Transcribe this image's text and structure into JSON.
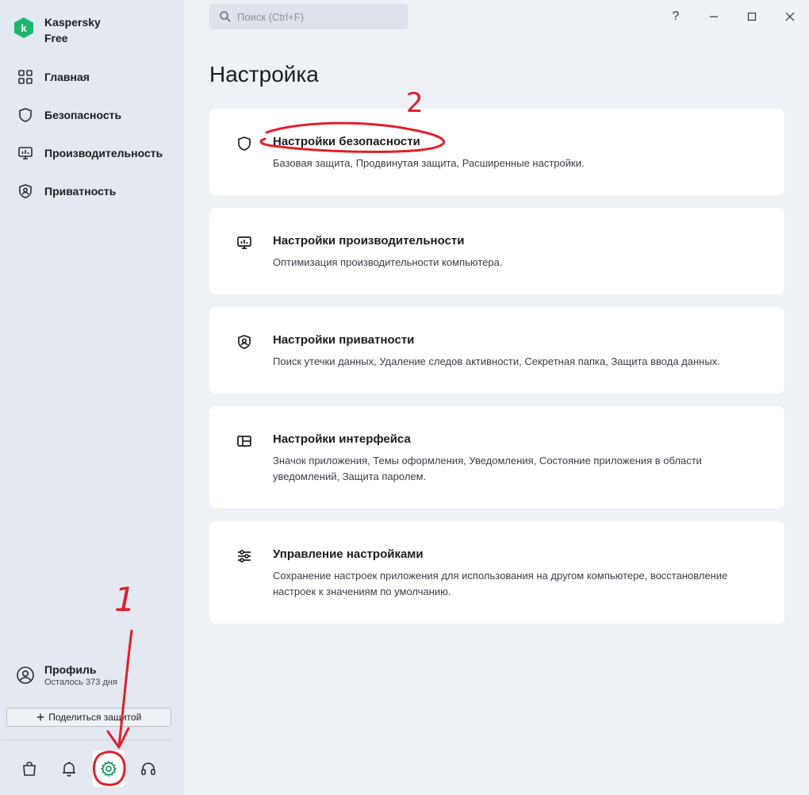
{
  "app": {
    "name_line1": "Kaspersky",
    "name_line2": "Free",
    "brand_color": "#1db46e"
  },
  "nav": [
    {
      "label": "Главная",
      "icon": "dashboard-icon"
    },
    {
      "label": "Безопасность",
      "icon": "shield-icon"
    },
    {
      "label": "Производительность",
      "icon": "monitor-icon"
    },
    {
      "label": "Приватность",
      "icon": "privacy-shield-icon"
    }
  ],
  "profile": {
    "title": "Профиль",
    "subtitle": "Осталось 373 дня"
  },
  "share_button": {
    "label": "Поделиться защитой"
  },
  "bottom_icons": [
    "store-icon",
    "bell-icon",
    "gear-icon",
    "headset-icon"
  ],
  "search": {
    "placeholder": "Поиск (Ctrl+F)"
  },
  "window_controls": {
    "help": "?"
  },
  "page": {
    "title": "Настройка"
  },
  "cards": [
    {
      "title": "Настройки безопасности",
      "desc": "Базовая защита, Продвинутая защита, Расширенные настройки.",
      "icon": "shield-icon"
    },
    {
      "title": "Настройки производительности",
      "desc": "Оптимизация производительности компьютера.",
      "icon": "monitor-icon"
    },
    {
      "title": "Настройки приватности",
      "desc": "Поиск утечки данных, Удаление следов активности, Секретная папка, Защита ввода данных.",
      "icon": "privacy-shield-icon"
    },
    {
      "title": "Настройки интерфейса",
      "desc": "Значок приложения, Темы оформления, Уведомления, Состояние приложения в области уведомлений, Защита паролем.",
      "icon": "layout-icon"
    },
    {
      "title": "Управление настройками",
      "desc": "Сохранение настроек приложения для использования на другом компьютере, восстановление настроек к значениям по умолчанию.",
      "icon": "sliders-icon"
    }
  ],
  "annotations": {
    "label1": "1",
    "label2": "2",
    "color": "#e0202a"
  }
}
